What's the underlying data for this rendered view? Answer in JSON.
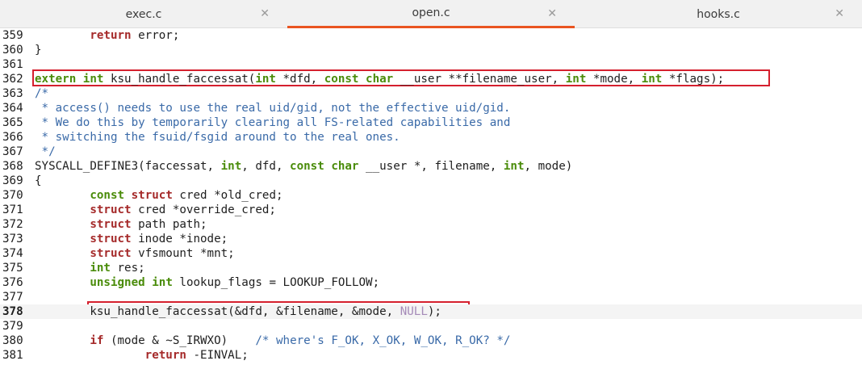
{
  "tabs": [
    {
      "label": "exec.c",
      "active": false
    },
    {
      "label": "open.c",
      "active": true
    },
    {
      "label": "hooks.c",
      "active": false
    }
  ],
  "tab_close_glyph": "✕",
  "colors": {
    "accent": "#e95420",
    "highlight_box": "#d5202e",
    "keyword": "#4a8c0a",
    "type_keyword": "#a52a2a",
    "comment": "#3a6aa8"
  },
  "lines": [
    {
      "n": "359",
      "tokens": [
        [
          "",
          "        "
        ],
        [
          "kb",
          "return"
        ],
        [
          "",
          " error;"
        ]
      ]
    },
    {
      "n": "360",
      "tokens": [
        [
          "",
          "}"
        ]
      ]
    },
    {
      "n": "361",
      "tokens": []
    },
    {
      "n": "362",
      "tokens": [
        [
          "k",
          "extern"
        ],
        [
          "",
          " "
        ],
        [
          "k",
          "int"
        ],
        [
          "",
          " ksu_handle_faccessat("
        ],
        [
          "k",
          "int"
        ],
        [
          "",
          " *dfd, "
        ],
        [
          "k",
          "const"
        ],
        [
          "",
          " "
        ],
        [
          "k",
          "char"
        ],
        [
          "",
          " __user **filename_user, "
        ],
        [
          "k",
          "int"
        ],
        [
          "",
          " *mode, "
        ],
        [
          "k",
          "int"
        ],
        [
          "",
          " *flags);"
        ]
      ]
    },
    {
      "n": "363",
      "tokens": [
        [
          "c",
          "/*"
        ]
      ]
    },
    {
      "n": "364",
      "tokens": [
        [
          "c",
          " * access() needs to use the real uid/gid, not the effective uid/gid."
        ]
      ]
    },
    {
      "n": "365",
      "tokens": [
        [
          "c",
          " * We do this by temporarily clearing all FS-related capabilities and"
        ]
      ]
    },
    {
      "n": "366",
      "tokens": [
        [
          "c",
          " * switching the fsuid/fsgid around to the real ones."
        ]
      ]
    },
    {
      "n": "367",
      "tokens": [
        [
          "c",
          " */"
        ]
      ]
    },
    {
      "n": "368",
      "tokens": [
        [
          "",
          "SYSCALL_DEFINE3(faccessat, "
        ],
        [
          "k",
          "int"
        ],
        [
          "",
          ", dfd, "
        ],
        [
          "k",
          "const"
        ],
        [
          "",
          " "
        ],
        [
          "k",
          "char"
        ],
        [
          "",
          " __user *, filename, "
        ],
        [
          "k",
          "int"
        ],
        [
          "",
          ", mode)"
        ]
      ]
    },
    {
      "n": "369",
      "tokens": [
        [
          "",
          "{"
        ]
      ]
    },
    {
      "n": "370",
      "tokens": [
        [
          "",
          "        "
        ],
        [
          "k",
          "const"
        ],
        [
          "",
          " "
        ],
        [
          "kb",
          "struct"
        ],
        [
          "",
          " cred *old_cred;"
        ]
      ]
    },
    {
      "n": "371",
      "tokens": [
        [
          "",
          "        "
        ],
        [
          "kb",
          "struct"
        ],
        [
          "",
          " cred *override_cred;"
        ]
      ]
    },
    {
      "n": "372",
      "tokens": [
        [
          "",
          "        "
        ],
        [
          "kb",
          "struct"
        ],
        [
          "",
          " path path;"
        ]
      ]
    },
    {
      "n": "373",
      "tokens": [
        [
          "",
          "        "
        ],
        [
          "kb",
          "struct"
        ],
        [
          "",
          " inode *inode;"
        ]
      ]
    },
    {
      "n": "374",
      "tokens": [
        [
          "",
          "        "
        ],
        [
          "kb",
          "struct"
        ],
        [
          "",
          " vfsmount *mnt;"
        ]
      ]
    },
    {
      "n": "375",
      "tokens": [
        [
          "",
          "        "
        ],
        [
          "k",
          "int"
        ],
        [
          "",
          " res;"
        ]
      ]
    },
    {
      "n": "376",
      "tokens": [
        [
          "",
          "        "
        ],
        [
          "k",
          "unsigned"
        ],
        [
          "",
          " "
        ],
        [
          "k",
          "int"
        ],
        [
          "",
          " lookup_flags = LOOKUP_FOLLOW;"
        ]
      ]
    },
    {
      "n": "377",
      "tokens": []
    },
    {
      "n": "378",
      "current": true,
      "tokens": [
        [
          "",
          "        ksu_handle_faccessat(&dfd, &filename, &mode, "
        ],
        [
          "nul",
          "NULL"
        ],
        [
          "",
          ");"
        ]
      ]
    },
    {
      "n": "379",
      "tokens": []
    },
    {
      "n": "380",
      "tokens": [
        [
          "",
          "        "
        ],
        [
          "kb",
          "if"
        ],
        [
          "",
          " (mode & ~S_IRWXO)    "
        ],
        [
          "c",
          "/* where's F_OK, X_OK, W_OK, R_OK? */"
        ]
      ]
    },
    {
      "n": "381",
      "tokens": [
        [
          "",
          "                "
        ],
        [
          "kb",
          "return"
        ],
        [
          "",
          " -EINVAL;"
        ]
      ]
    }
  ]
}
